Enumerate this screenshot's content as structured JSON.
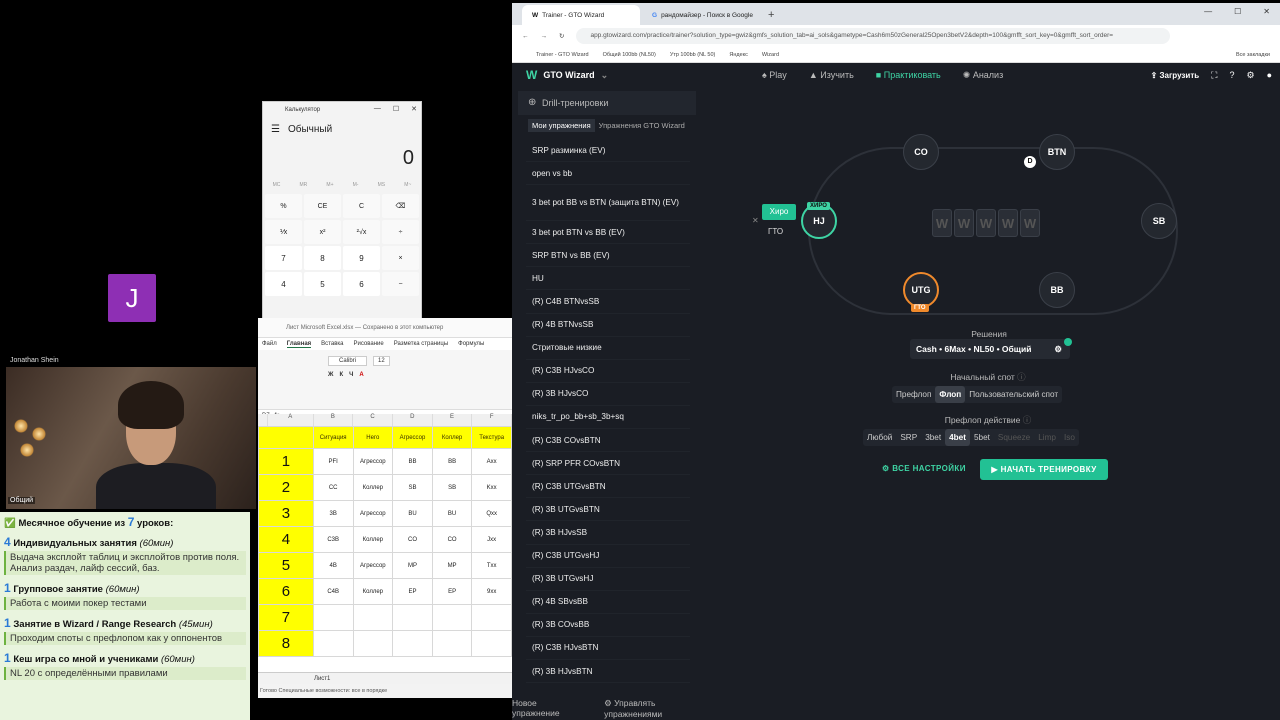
{
  "video": {
    "avatar_letter": "J",
    "participant_name": "Jonathan Shein",
    "cam_label": "Общий"
  },
  "promo": {
    "headline_prefix": "Месячное обучение из",
    "headline_num": "7",
    "headline_suffix": "уроков:",
    "items": [
      {
        "num": "4",
        "title": "Индивидуальных занятия",
        "dur": "(60мин)",
        "quote": "Выдача эксплойт таблиц и эксплойтов против поля. Анализ раздач, лайф сессий, баз."
      },
      {
        "num": "1",
        "title": "Групповое занятие",
        "dur": "(60мин)",
        "quote": "Работа с моими покер тестами"
      },
      {
        "num": "1",
        "title": "Занятие в Wizard / Range Research",
        "dur": "(45мин)",
        "quote": "Проходим споты с префлопом как у оппонентов"
      },
      {
        "num": "1",
        "title": "Кеш игра со мной и учениками",
        "dur": "(60мин)",
        "quote": "NL 20 с определёнными правилами"
      }
    ]
  },
  "calculator": {
    "title": "Калькулятор",
    "mode": "Обычный",
    "display": "0",
    "memory": [
      "MC",
      "MR",
      "M+",
      "M-",
      "MS",
      "M~"
    ],
    "keys": [
      "%",
      "CE",
      "C",
      "⌫",
      "⅟x",
      "x²",
      "²√x",
      "÷",
      "7",
      "8",
      "9",
      "×",
      "4",
      "5",
      "6",
      "−"
    ]
  },
  "sheet": {
    "title": "Лист Microsoft Excel.xlsx — Сохранено в этот компьютер",
    "tabs": [
      "Файл",
      "Главная",
      "Вставка",
      "Рисование",
      "Разметка страницы",
      "Формулы"
    ],
    "cell_ref": "D7",
    "font": "Calibri",
    "font_size": "12",
    "col_letters": [
      "A",
      "B",
      "C",
      "D",
      "E",
      "F"
    ],
    "headers": [
      "Ситуация",
      "Него",
      "Агрессор",
      "Коллер",
      "Текстура"
    ],
    "rows": [
      {
        "n": "1",
        "c": [
          "PFI",
          "Агрессор",
          "BB",
          "BB",
          "Axx"
        ]
      },
      {
        "n": "2",
        "c": [
          "CC",
          "Коллер",
          "SB",
          "SB",
          "Kxx"
        ]
      },
      {
        "n": "3",
        "c": [
          "3B",
          "Агрессор",
          "BU",
          "BU",
          "Qxx"
        ]
      },
      {
        "n": "4",
        "c": [
          "C3B",
          "Коллер",
          "CO",
          "CO",
          "Jxx"
        ]
      },
      {
        "n": "5",
        "c": [
          "4B",
          "Агрессор",
          "MP",
          "MP",
          "Txx"
        ]
      },
      {
        "n": "6",
        "c": [
          "C4B",
          "Коллер",
          "EP",
          "EP",
          "9xx"
        ]
      },
      {
        "n": "7",
        "c": [
          "",
          "",
          "",
          "",
          ""
        ]
      },
      {
        "n": "8",
        "c": [
          "",
          "",
          "",
          "",
          ""
        ]
      }
    ],
    "sheet_tab": "Лист1",
    "status": "Готово   Специальные возможности: все в порядке"
  },
  "browser": {
    "tabs": [
      "Trainer - GTO Wizard",
      "рандомайзер - Поиск в Google"
    ],
    "url": "app.gtowizard.com/practice/trainer?solution_type=gwiz&gmfs_solution_tab=ai_sols&gametype=Cash6m50zGeneral25Open3betV2&depth=100&gmfft_sort_key=0&gmfft_sort_order=",
    "bookmarks": [
      "Trainer - GTO Wizard",
      "Общий 100bb (NL50)",
      "Утр 100bb (NL 50)",
      "Яндекс",
      "Wizard"
    ],
    "all_bookmarks": "Все закладки"
  },
  "gw": {
    "brand": "GTO Wizard",
    "nav": [
      "Play",
      "Изучить",
      "Практиковать",
      "Анализ"
    ],
    "upload": "Загрузить",
    "drill_header": "Drill-тренировки",
    "subtabs": [
      "Мои упражнения",
      "Упражнения GTO Wizard"
    ],
    "drills": [
      "SRP разминка (EV)",
      "open vs bb",
      "3 bet pot BB vs BTN (защита BTN) (EV)",
      "3 bet pot BTN vs BB (EV)",
      "SRP BTN vs BB (EV)",
      "HU",
      "(R) C4B BTNvsSB",
      "(R) 4B BTNvsSB",
      "Стритовые низкие",
      "(R) C3B HJvsCO",
      "(R) 3B HJvsCO",
      "niks_tr_po_bb+sb_3b+sq",
      "(R) C3B COvsBTN",
      "(R) SRP PFR COvsBTN",
      "(R) C3B UTGvsBTN",
      "(R) 3B UTGvsBTN",
      "(R) 3B HJvsSB",
      "(R) C3B UTGvsHJ",
      "(R) 3B UTGvsHJ",
      "(R) 4B SBvsBB",
      "(R) 3B COvsBB",
      "(R) C3B HJvsBTN",
      "(R) 3B HJvsBTN"
    ],
    "footer": [
      "Новое упражнение",
      "Управлять упражнениями"
    ],
    "seats": {
      "co": "CO",
      "btn": "BTN",
      "sb": "SB",
      "bb": "BB",
      "utg": "UTG",
      "hj": "HJ"
    },
    "dealer": "D",
    "hero_badge": "ХИРО",
    "gto_badge": "ГТО",
    "hero_pill": "Хиро",
    "gto_label": "ГТО",
    "board": [
      "W",
      "W",
      "W",
      "W",
      "W"
    ],
    "solutions_label": "Решения",
    "solution_value": "Cash • 6Max • NL50 • Общий",
    "start_spot_label": "Начальный спот",
    "start_spot": [
      "Префлоп",
      "Флоп",
      "Пользовательский спот"
    ],
    "preflop_action_label": "Префлоп действие",
    "preflop_action": [
      "Любой",
      "SRP",
      "3bet",
      "4bet",
      "5bet",
      "Squeeze",
      "Limp",
      "Iso"
    ],
    "all_settings": "ВСЕ НАСТРОЙКИ",
    "start_training": "НАЧАТЬ ТРЕНИРОВКУ"
  }
}
